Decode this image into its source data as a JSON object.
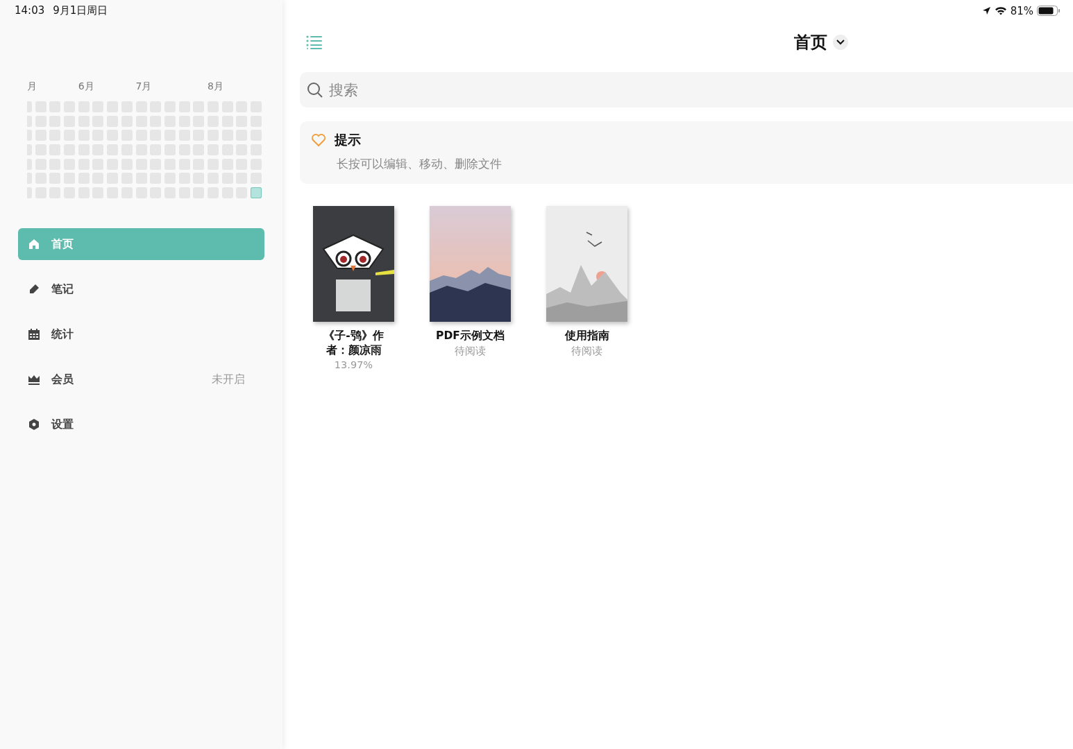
{
  "status_bar": {
    "time": "14:03",
    "date": "9月1日周日",
    "battery": "81%"
  },
  "sidebar": {
    "months": [
      "月",
      "6月",
      "7月",
      "8月"
    ],
    "heatmap": [
      [
        false,
        false,
        false,
        false,
        false,
        false,
        false
      ],
      [
        false,
        false,
        false,
        false,
        false,
        false,
        false
      ],
      [
        false,
        false,
        false,
        false,
        false,
        false,
        false
      ],
      [
        false,
        false,
        false,
        false,
        false,
        false,
        false
      ],
      [
        false,
        false,
        false,
        false,
        false,
        false,
        false
      ],
      [
        false,
        false,
        false,
        false,
        false,
        false,
        false
      ],
      [
        false,
        false,
        false,
        false,
        false,
        false,
        false
      ],
      [
        false,
        false,
        false,
        false,
        false,
        false,
        false
      ],
      [
        false,
        false,
        false,
        false,
        false,
        false,
        false
      ],
      [
        false,
        false,
        false,
        false,
        false,
        false,
        false
      ],
      [
        false,
        false,
        false,
        false,
        false,
        false,
        false
      ],
      [
        false,
        false,
        false,
        false,
        false,
        false,
        false
      ],
      [
        false,
        false,
        false,
        false,
        false,
        false,
        false
      ],
      [
        false,
        false,
        false,
        false,
        false,
        false,
        false
      ],
      [
        false,
        false,
        false,
        false,
        false,
        false,
        false
      ],
      [
        false,
        false,
        false,
        false,
        false,
        false,
        false
      ],
      [
        false,
        false,
        false,
        false,
        false,
        false,
        true
      ]
    ],
    "items": [
      {
        "label": "首页",
        "selected": true
      },
      {
        "label": "笔记",
        "selected": false
      },
      {
        "label": "统计",
        "selected": false
      },
      {
        "label": "会员",
        "selected": false,
        "badge": "未开启"
      },
      {
        "label": "设置",
        "selected": false
      }
    ]
  },
  "main": {
    "title": "首页",
    "search": {
      "placeholder": "搜索"
    },
    "tip": {
      "title": "提示",
      "text": "长按可以编辑、移动、删除文件"
    },
    "books": [
      {
        "title": "《子-鸮》作者：颜凉雨",
        "status": "13.97%"
      },
      {
        "title": "PDF示例文档",
        "status": "待阅读"
      },
      {
        "title": "使用指南",
        "status": "待阅读"
      }
    ]
  }
}
